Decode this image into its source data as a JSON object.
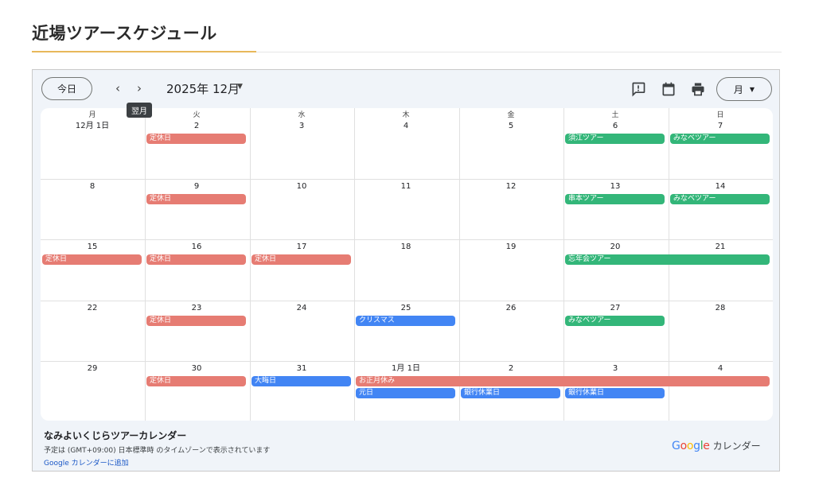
{
  "page": {
    "title": "近場ツアースケジュール"
  },
  "toolbar": {
    "today_label": "今日",
    "prev_label": "‹",
    "next_label": "›",
    "tooltip": "翌月",
    "month_label": "2025年 12月",
    "view_label": "月",
    "caret": "▼"
  },
  "weekdays": [
    "月",
    "火",
    "水",
    "木",
    "金",
    "土",
    "日"
  ],
  "weeks": [
    [
      "12月 1日",
      "2",
      "3",
      "4",
      "5",
      "6",
      "7"
    ],
    [
      "8",
      "9",
      "10",
      "11",
      "12",
      "13",
      "14"
    ],
    [
      "15",
      "16",
      "17",
      "18",
      "19",
      "20",
      "21"
    ],
    [
      "22",
      "23",
      "24",
      "25",
      "26",
      "27",
      "28"
    ],
    [
      "29",
      "30",
      "31",
      "1月 1日",
      "2",
      "3",
      "4"
    ]
  ],
  "events": [
    {
      "week": 0,
      "day": 1,
      "span": 1,
      "lane": 0,
      "text": "定休日",
      "color": "red"
    },
    {
      "week": 0,
      "day": 5,
      "span": 1,
      "lane": 0,
      "text": "須江ツアー",
      "color": "green"
    },
    {
      "week": 0,
      "day": 6,
      "span": 1,
      "lane": 0,
      "text": "みなベツアー",
      "color": "green"
    },
    {
      "week": 1,
      "day": 1,
      "span": 1,
      "lane": 0,
      "text": "定休日",
      "color": "red"
    },
    {
      "week": 1,
      "day": 5,
      "span": 1,
      "lane": 0,
      "text": "串本ツアー",
      "color": "green"
    },
    {
      "week": 1,
      "day": 6,
      "span": 1,
      "lane": 0,
      "text": "みなベツアー",
      "color": "green"
    },
    {
      "week": 2,
      "day": 0,
      "span": 1,
      "lane": 0,
      "text": "定休日",
      "color": "red"
    },
    {
      "week": 2,
      "day": 1,
      "span": 1,
      "lane": 0,
      "text": "定休日",
      "color": "red"
    },
    {
      "week": 2,
      "day": 2,
      "span": 1,
      "lane": 0,
      "text": "定休日",
      "color": "red"
    },
    {
      "week": 2,
      "day": 5,
      "span": 2,
      "lane": 0,
      "text": "忘年会ツアー",
      "color": "green"
    },
    {
      "week": 3,
      "day": 1,
      "span": 1,
      "lane": 0,
      "text": "定休日",
      "color": "red"
    },
    {
      "week": 3,
      "day": 3,
      "span": 1,
      "lane": 0,
      "text": "クリスマス",
      "color": "blue"
    },
    {
      "week": 3,
      "day": 5,
      "span": 1,
      "lane": 0,
      "text": "みなベツアー",
      "color": "green"
    },
    {
      "week": 4,
      "day": 1,
      "span": 1,
      "lane": 0,
      "text": "定休日",
      "color": "red"
    },
    {
      "week": 4,
      "day": 2,
      "span": 1,
      "lane": 0,
      "text": "大晦日",
      "color": "blue"
    },
    {
      "week": 4,
      "day": 3,
      "span": 4,
      "lane": 0,
      "text": "お正月休み",
      "color": "red"
    },
    {
      "week": 4,
      "day": 3,
      "span": 1,
      "lane": 1,
      "text": "元日",
      "color": "blue"
    },
    {
      "week": 4,
      "day": 4,
      "span": 1,
      "lane": 1,
      "text": "銀行休業日",
      "color": "blue"
    },
    {
      "week": 4,
      "day": 5,
      "span": 1,
      "lane": 1,
      "text": "銀行休業日",
      "color": "blue"
    }
  ],
  "colors": {
    "red": "#e67c73",
    "green": "#33b679",
    "blue": "#4285f4"
  },
  "footer": {
    "calendar_name": "なみよいくじらツアーカレンダー",
    "timezone_note": "予定は (GMT+09:00) 日本標準時 のタイムゾーンで表示されています",
    "add_link": "Google カレンダーに追加",
    "brand_text": "カレンダー"
  },
  "icons": [
    "feedback-icon",
    "calendar-icon",
    "print-icon"
  ]
}
